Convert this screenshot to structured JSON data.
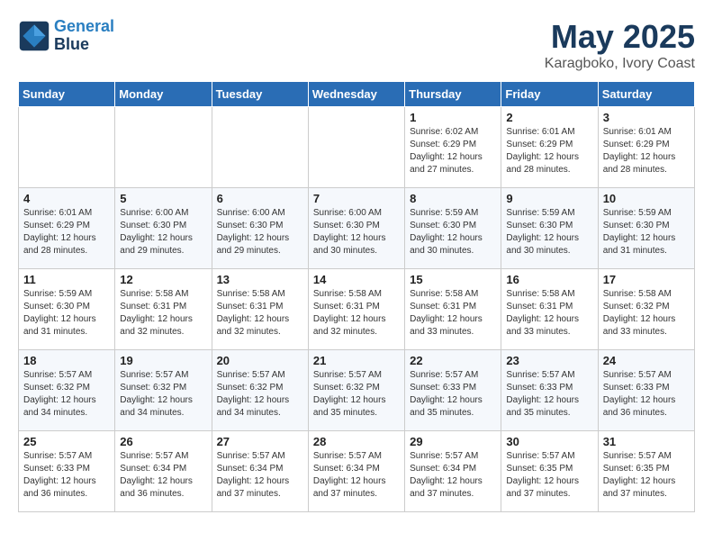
{
  "header": {
    "logo_line1": "General",
    "logo_line2": "Blue",
    "title": "May 2025",
    "subtitle": "Karagboko, Ivory Coast"
  },
  "weekdays": [
    "Sunday",
    "Monday",
    "Tuesday",
    "Wednesday",
    "Thursday",
    "Friday",
    "Saturday"
  ],
  "weeks": [
    [
      {
        "day": "",
        "info": ""
      },
      {
        "day": "",
        "info": ""
      },
      {
        "day": "",
        "info": ""
      },
      {
        "day": "",
        "info": ""
      },
      {
        "day": "1",
        "info": "Sunrise: 6:02 AM\nSunset: 6:29 PM\nDaylight: 12 hours\nand 27 minutes."
      },
      {
        "day": "2",
        "info": "Sunrise: 6:01 AM\nSunset: 6:29 PM\nDaylight: 12 hours\nand 28 minutes."
      },
      {
        "day": "3",
        "info": "Sunrise: 6:01 AM\nSunset: 6:29 PM\nDaylight: 12 hours\nand 28 minutes."
      }
    ],
    [
      {
        "day": "4",
        "info": "Sunrise: 6:01 AM\nSunset: 6:29 PM\nDaylight: 12 hours\nand 28 minutes."
      },
      {
        "day": "5",
        "info": "Sunrise: 6:00 AM\nSunset: 6:30 PM\nDaylight: 12 hours\nand 29 minutes."
      },
      {
        "day": "6",
        "info": "Sunrise: 6:00 AM\nSunset: 6:30 PM\nDaylight: 12 hours\nand 29 minutes."
      },
      {
        "day": "7",
        "info": "Sunrise: 6:00 AM\nSunset: 6:30 PM\nDaylight: 12 hours\nand 30 minutes."
      },
      {
        "day": "8",
        "info": "Sunrise: 5:59 AM\nSunset: 6:30 PM\nDaylight: 12 hours\nand 30 minutes."
      },
      {
        "day": "9",
        "info": "Sunrise: 5:59 AM\nSunset: 6:30 PM\nDaylight: 12 hours\nand 30 minutes."
      },
      {
        "day": "10",
        "info": "Sunrise: 5:59 AM\nSunset: 6:30 PM\nDaylight: 12 hours\nand 31 minutes."
      }
    ],
    [
      {
        "day": "11",
        "info": "Sunrise: 5:59 AM\nSunset: 6:30 PM\nDaylight: 12 hours\nand 31 minutes."
      },
      {
        "day": "12",
        "info": "Sunrise: 5:58 AM\nSunset: 6:31 PM\nDaylight: 12 hours\nand 32 minutes."
      },
      {
        "day": "13",
        "info": "Sunrise: 5:58 AM\nSunset: 6:31 PM\nDaylight: 12 hours\nand 32 minutes."
      },
      {
        "day": "14",
        "info": "Sunrise: 5:58 AM\nSunset: 6:31 PM\nDaylight: 12 hours\nand 32 minutes."
      },
      {
        "day": "15",
        "info": "Sunrise: 5:58 AM\nSunset: 6:31 PM\nDaylight: 12 hours\nand 33 minutes."
      },
      {
        "day": "16",
        "info": "Sunrise: 5:58 AM\nSunset: 6:31 PM\nDaylight: 12 hours\nand 33 minutes."
      },
      {
        "day": "17",
        "info": "Sunrise: 5:58 AM\nSunset: 6:32 PM\nDaylight: 12 hours\nand 33 minutes."
      }
    ],
    [
      {
        "day": "18",
        "info": "Sunrise: 5:57 AM\nSunset: 6:32 PM\nDaylight: 12 hours\nand 34 minutes."
      },
      {
        "day": "19",
        "info": "Sunrise: 5:57 AM\nSunset: 6:32 PM\nDaylight: 12 hours\nand 34 minutes."
      },
      {
        "day": "20",
        "info": "Sunrise: 5:57 AM\nSunset: 6:32 PM\nDaylight: 12 hours\nand 34 minutes."
      },
      {
        "day": "21",
        "info": "Sunrise: 5:57 AM\nSunset: 6:32 PM\nDaylight: 12 hours\nand 35 minutes."
      },
      {
        "day": "22",
        "info": "Sunrise: 5:57 AM\nSunset: 6:33 PM\nDaylight: 12 hours\nand 35 minutes."
      },
      {
        "day": "23",
        "info": "Sunrise: 5:57 AM\nSunset: 6:33 PM\nDaylight: 12 hours\nand 35 minutes."
      },
      {
        "day": "24",
        "info": "Sunrise: 5:57 AM\nSunset: 6:33 PM\nDaylight: 12 hours\nand 36 minutes."
      }
    ],
    [
      {
        "day": "25",
        "info": "Sunrise: 5:57 AM\nSunset: 6:33 PM\nDaylight: 12 hours\nand 36 minutes."
      },
      {
        "day": "26",
        "info": "Sunrise: 5:57 AM\nSunset: 6:34 PM\nDaylight: 12 hours\nand 36 minutes."
      },
      {
        "day": "27",
        "info": "Sunrise: 5:57 AM\nSunset: 6:34 PM\nDaylight: 12 hours\nand 37 minutes."
      },
      {
        "day": "28",
        "info": "Sunrise: 5:57 AM\nSunset: 6:34 PM\nDaylight: 12 hours\nand 37 minutes."
      },
      {
        "day": "29",
        "info": "Sunrise: 5:57 AM\nSunset: 6:34 PM\nDaylight: 12 hours\nand 37 minutes."
      },
      {
        "day": "30",
        "info": "Sunrise: 5:57 AM\nSunset: 6:35 PM\nDaylight: 12 hours\nand 37 minutes."
      },
      {
        "day": "31",
        "info": "Sunrise: 5:57 AM\nSunset: 6:35 PM\nDaylight: 12 hours\nand 37 minutes."
      }
    ]
  ]
}
